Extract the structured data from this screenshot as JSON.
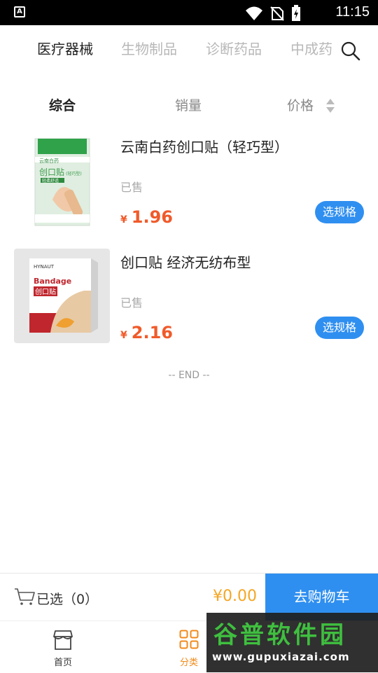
{
  "status_bar": {
    "time": "11:15",
    "app_icon_letter": "A"
  },
  "category_tabs": [
    {
      "label": "医疗器械",
      "active": true
    },
    {
      "label": "生物制品",
      "active": false
    },
    {
      "label": "诊断药品",
      "active": false
    },
    {
      "label": "中成药",
      "active": false
    }
  ],
  "sort_bar": {
    "composite": "综合",
    "sales": "销量",
    "price": "价格"
  },
  "products": [
    {
      "name": "云南白药创口贴（轻巧型）",
      "sold_label": "已售",
      "currency": "¥",
      "price": "1.96",
      "spec_button": "选规格",
      "image_text": {
        "brand": "云南白药",
        "title": "创口贴",
        "sub": "(轻巧型)",
        "tag": "轻柔舒适"
      }
    },
    {
      "name": "创口贴 经济无纺布型",
      "sold_label": "已售",
      "currency": "¥",
      "price": "2.16",
      "spec_button": "选规格",
      "image_text": {
        "brand": "HYNAUT",
        "en": "Bandage",
        "title": "创口贴"
      }
    }
  ],
  "list_end": "-- END --",
  "cart_bar": {
    "selected_label": "已选",
    "selected_count": "（0）",
    "total": "¥0.00",
    "go_cart": "去购物车"
  },
  "bottom_nav": [
    {
      "label": "首页",
      "icon": "store-icon",
      "active": false
    },
    {
      "label": "分类",
      "icon": "grid-icon",
      "active": true
    }
  ],
  "watermark": {
    "text": "谷普软件园",
    "url": "www.gupuxiazai.com"
  },
  "colors": {
    "accent_blue": "#2f8ff0",
    "price_red": "#f05a2a",
    "total_orange": "#f5a623",
    "nav_active": "#f08a1a"
  }
}
